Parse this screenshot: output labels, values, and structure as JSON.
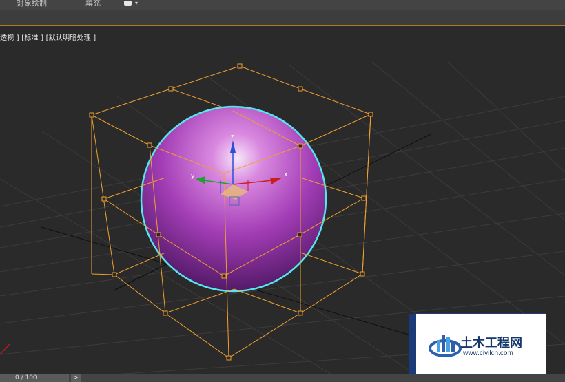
{
  "topbar": {
    "tab_object_paint": "对象绘制",
    "tab_fill": "填充"
  },
  "viewport": {
    "label": "透视 ] [标准 ] [默认明暗处理 ]",
    "gizmo_x": "x",
    "gizmo_y": "y",
    "gizmo_z": "z"
  },
  "watermark": {
    "title": "土木工程网",
    "url": "www.civilcn.com"
  },
  "timeline": {
    "frame": "0 / 100",
    "next": ">"
  },
  "colors": {
    "selection_box": "#f0a030",
    "sphere": "#b04ac0",
    "sphere_outline": "#56e6ef"
  }
}
